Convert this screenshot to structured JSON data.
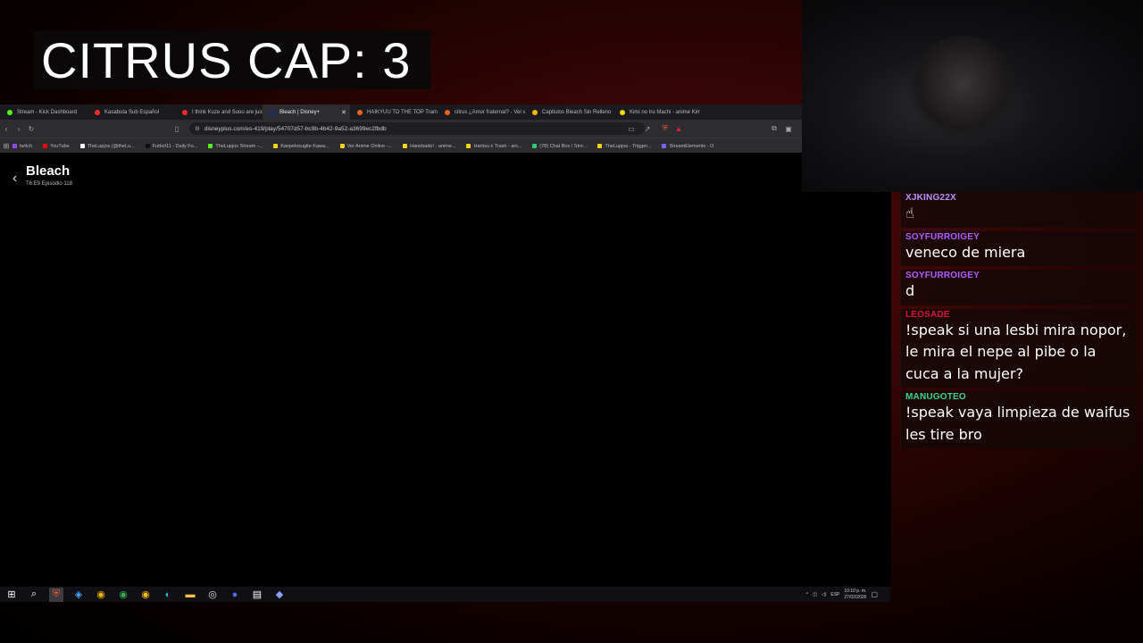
{
  "overlay": {
    "title": "CITRUS CAP: 3"
  },
  "browser": {
    "tabs": [
      {
        "label": "Stream - Kick Dashboard",
        "color": "#53fc18",
        "active": false
      },
      {
        "label": "Kasabuta Sub Español",
        "color": "#ff2a2a",
        "active": false
      },
      {
        "label": "I think Kuze and Suou are just",
        "color": "#ff2a2a",
        "active": false
      },
      {
        "label": "Bleach | Disney+",
        "color": "#1b2d73",
        "active": true
      },
      {
        "label": "HAIKYUU TO THE TOP Trampo",
        "color": "#e8631c",
        "active": false
      },
      {
        "label": "citrus ¿Amor fraternal? - Ver el",
        "color": "#e8631c",
        "active": false
      },
      {
        "label": "Capitulos Bleach Sin Relleno y",
        "color": "#f5b800",
        "active": false
      },
      {
        "label": "Kimi no Iru Machi - anime Kim",
        "color": "#ffd600",
        "active": false
      }
    ],
    "url": "disneyplus.com/es-419/play/54707d57-bc9b-4b42-9a52-a3699ec2fbdb",
    "bookmarks": [
      {
        "label": "twitch",
        "color": "#9146ff"
      },
      {
        "label": "YouTube",
        "color": "#ff0000"
      },
      {
        "label": "TheLupjos (@theLu...",
        "color": "#ffffff"
      },
      {
        "label": "Futbol11 - Daily Fo...",
        "color": "#111111"
      },
      {
        "label": "TheLupjos Stream -...",
        "color": "#53fc18"
      },
      {
        "label": "Kanpekisugite Kawa...",
        "color": "#ffd600"
      },
      {
        "label": "Ver Anime Online -...",
        "color": "#ffd600"
      },
      {
        "label": "Hanebado! - anime...",
        "color": "#ffd600"
      },
      {
        "label": "Hantsu x Trash - ani...",
        "color": "#ffd600"
      },
      {
        "label": "(78) Chat Box / Stre...",
        "color": "#2ecc71"
      },
      {
        "label": "TheLupjos - Trigger...",
        "color": "#ffd600"
      },
      {
        "label": "StreamElements - O",
        "color": "#7b61ff"
      }
    ]
  },
  "player": {
    "title": "Bleach",
    "subtitle": "T6:E9 Episodio 118"
  },
  "chat": [
    {
      "user": "XJKING22X",
      "color": "#b692ff",
      "text": "☝"
    },
    {
      "user": "SOYFURROIGEY",
      "color": "#b05cff",
      "text": "veneco de miera"
    },
    {
      "user": "SOYFURROIGEY",
      "color": "#b05cff",
      "text": "d"
    },
    {
      "user": "LEOSADE",
      "color": "#d4143c",
      "text": "!speak si una lesbi mira nopor, le mira el nepe al pibe o la cuca a la mujer?"
    },
    {
      "user": "MANUGOTEO",
      "color": "#3bd38c",
      "text": "!speak vaya limpieza de waifus les tire bro"
    }
  ],
  "taskbar": {
    "lang": "ESP",
    "time": "10:10 p. m.",
    "date": "27/02/2026"
  }
}
